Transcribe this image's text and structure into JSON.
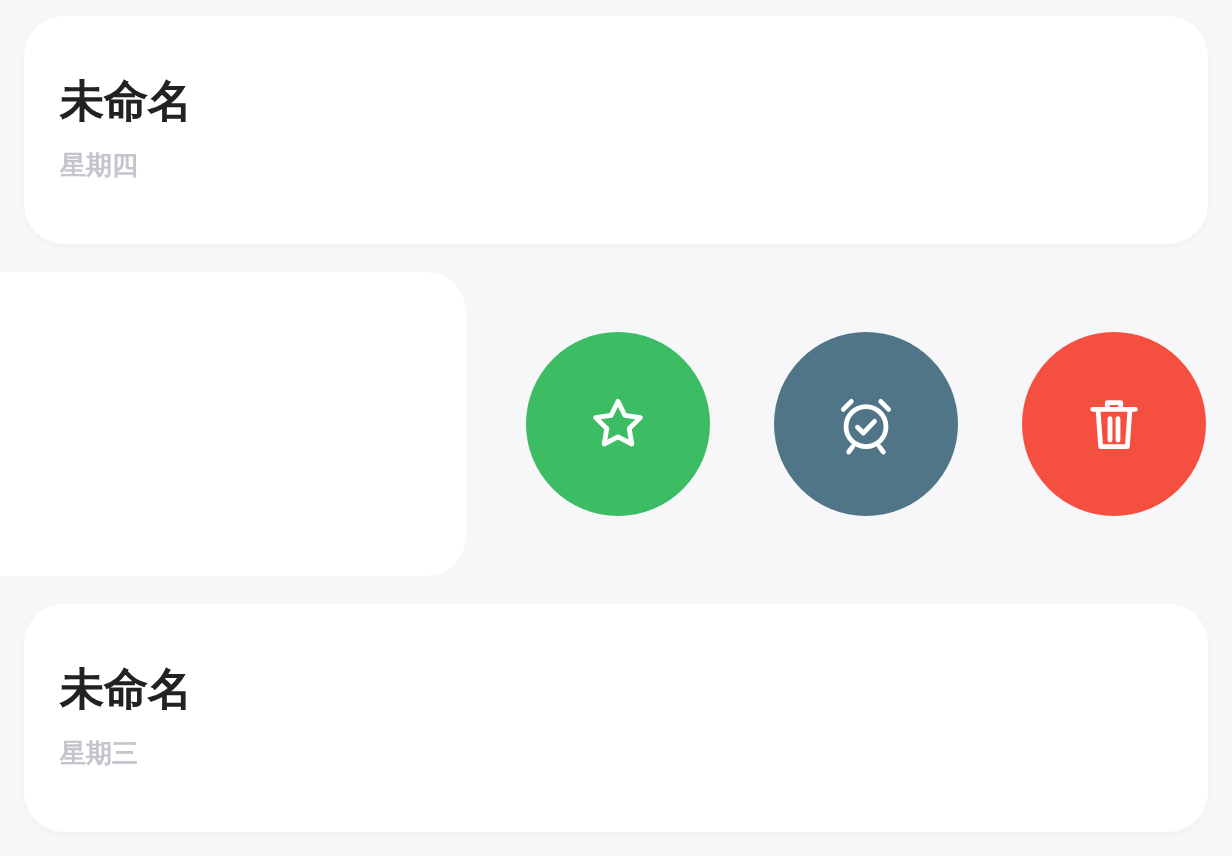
{
  "notes": [
    {
      "kind": "card",
      "title": "未命名",
      "day": "星期四"
    },
    {
      "kind": "swiped",
      "actions": [
        {
          "kind": "favorite",
          "color": "#3dbd63"
        },
        {
          "kind": "reminder",
          "color": "#4f7586"
        },
        {
          "kind": "delete",
          "color": "#f5503f"
        }
      ]
    },
    {
      "kind": "card",
      "title": "未命名",
      "day": "星期三"
    }
  ]
}
